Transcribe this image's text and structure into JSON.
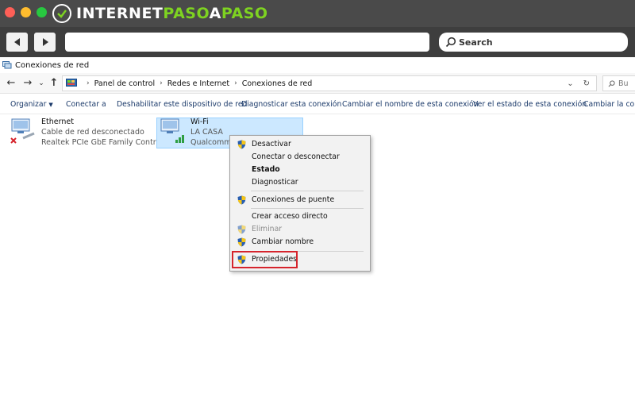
{
  "browser": {
    "logo_text_a": "INTERNET",
    "logo_text_b": "PASO",
    "logo_text_c": "A",
    "logo_text_d": "PASO",
    "search_placeholder": "Search"
  },
  "window": {
    "title": "Conexiones de red"
  },
  "address": {
    "crumbs": [
      "Panel de control",
      "Redes e Internet",
      "Conexiones de red"
    ],
    "search_placeholder": "Bu"
  },
  "commands": [
    "Organizar",
    "Conectar a",
    "Deshabilitar este dispositivo de red",
    "Diagnosticar esta conexión",
    "Cambiar el nombre de esta conexión",
    "Ver el estado de esta conexión",
    "Cambiar la confi"
  ],
  "connections": [
    {
      "name": "Ethernet",
      "status": "Cable de red desconectado",
      "adapter": "Realtek PCIe GbE Family Controller"
    },
    {
      "name": "Wi-Fi",
      "status": "LA CASA",
      "adapter": "Qualcomm A"
    }
  ],
  "context_menu": {
    "items": [
      {
        "label": "Desactivar",
        "shield": true,
        "bold": false,
        "disabled": false
      },
      {
        "label": "Conectar o desconectar",
        "shield": false,
        "bold": false,
        "disabled": false
      },
      {
        "label": "Estado",
        "shield": false,
        "bold": true,
        "disabled": false
      },
      {
        "label": "Diagnosticar",
        "shield": false,
        "bold": false,
        "disabled": false
      },
      {
        "label": "Conexiones de puente",
        "shield": true,
        "bold": false,
        "disabled": false
      },
      {
        "label": "Crear acceso directo",
        "shield": false,
        "bold": false,
        "disabled": false
      },
      {
        "label": "Eliminar",
        "shield": true,
        "bold": false,
        "disabled": true
      },
      {
        "label": "Cambiar nombre",
        "shield": true,
        "bold": false,
        "disabled": false
      },
      {
        "label": "Propiedades",
        "shield": true,
        "bold": false,
        "disabled": false
      }
    ]
  },
  "colors": {
    "highlight": "#d6242c",
    "selection": "#cce8ff",
    "logo_accent": "#7ed321"
  }
}
